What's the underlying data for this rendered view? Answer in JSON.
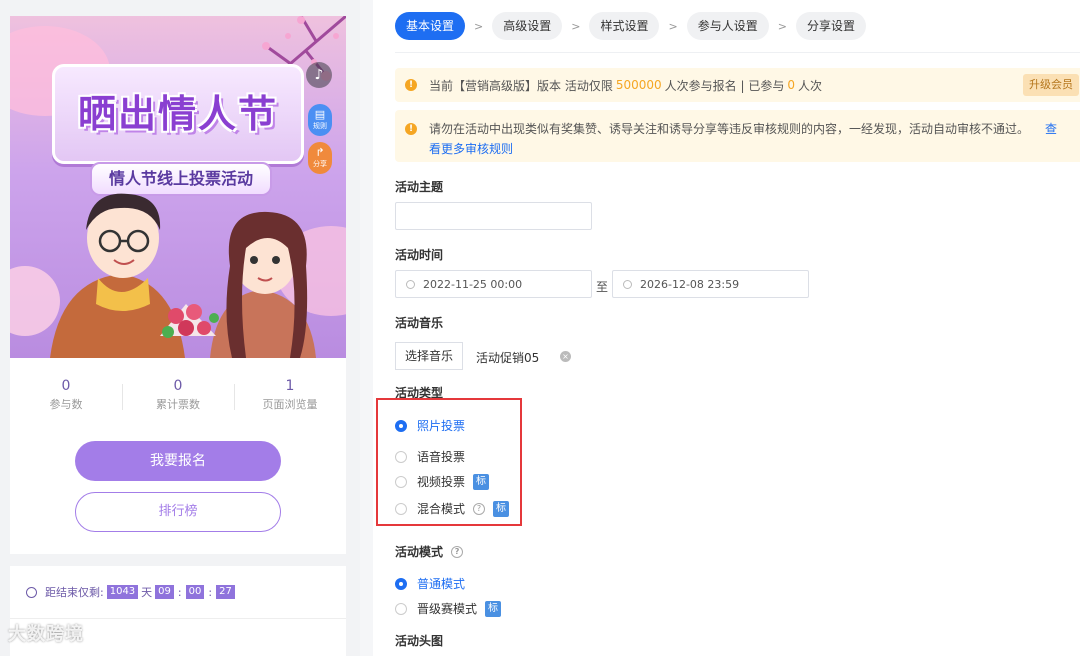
{
  "preview": {
    "poster": {
      "title": "晒出情人节",
      "subtitle": "情人节线上投票活动",
      "music_icon": "music-note-icon",
      "rule_label": "规则",
      "share_label": "分享"
    },
    "stats": [
      {
        "value": "0",
        "label": "参与数"
      },
      {
        "value": "0",
        "label": "累计票数"
      },
      {
        "value": "1",
        "label": "页面浏览量"
      }
    ],
    "join_label": "我要报名",
    "rank_label": "排行榜",
    "countdown": {
      "prefix": "距结束仅剩:",
      "days": "1043",
      "day_unit": "天",
      "hours": "09",
      "minutes": "00",
      "seconds": "27"
    },
    "watermark": "大数跨境"
  },
  "steps": [
    "基本设置",
    "高级设置",
    "样式设置",
    "参与人设置",
    "分享设置"
  ],
  "notice1": {
    "text_a": "当前【营销高级版】版本 活动仅限",
    "limit": "500000",
    "text_b": "人次参与报名 | 已参与",
    "joined": "0",
    "text_c": "人次",
    "upgrade": "升级会员"
  },
  "notice2": {
    "text": "请勿在活动中出现类似有奖集赞、诱导关注和诱导分享等违反审核规则的内容，一经发现，活动自动审核不通过。",
    "link_tail": "查",
    "link": "看更多审核规则"
  },
  "form": {
    "theme_label": "活动主题",
    "theme_value": "",
    "time_label": "活动时间",
    "start_time": "2022-11-25 00:00",
    "to": "至",
    "end_time": "2026-12-08 23:59",
    "music_label": "活动音乐",
    "music_button": "选择音乐",
    "music_name": "活动促销05",
    "type_label": "活动类型",
    "types": [
      {
        "label": "照片投票",
        "checked": true
      },
      {
        "label": "语音投票",
        "checked": false
      },
      {
        "label": "视频投票",
        "checked": false,
        "tag": "标"
      },
      {
        "label": "混合模式",
        "checked": false,
        "tag": "标"
      }
    ],
    "mode_label": "活动模式",
    "modes": [
      {
        "label": "普通模式",
        "checked": true
      },
      {
        "label": "晋级赛模式",
        "checked": false,
        "tag": "标"
      }
    ],
    "head_label": "活动头图"
  },
  "colors": {
    "primary": "#1e6ef2",
    "accent": "#a37de8",
    "warning_bg": "#fff8e6",
    "highlight": "#e5383b"
  }
}
